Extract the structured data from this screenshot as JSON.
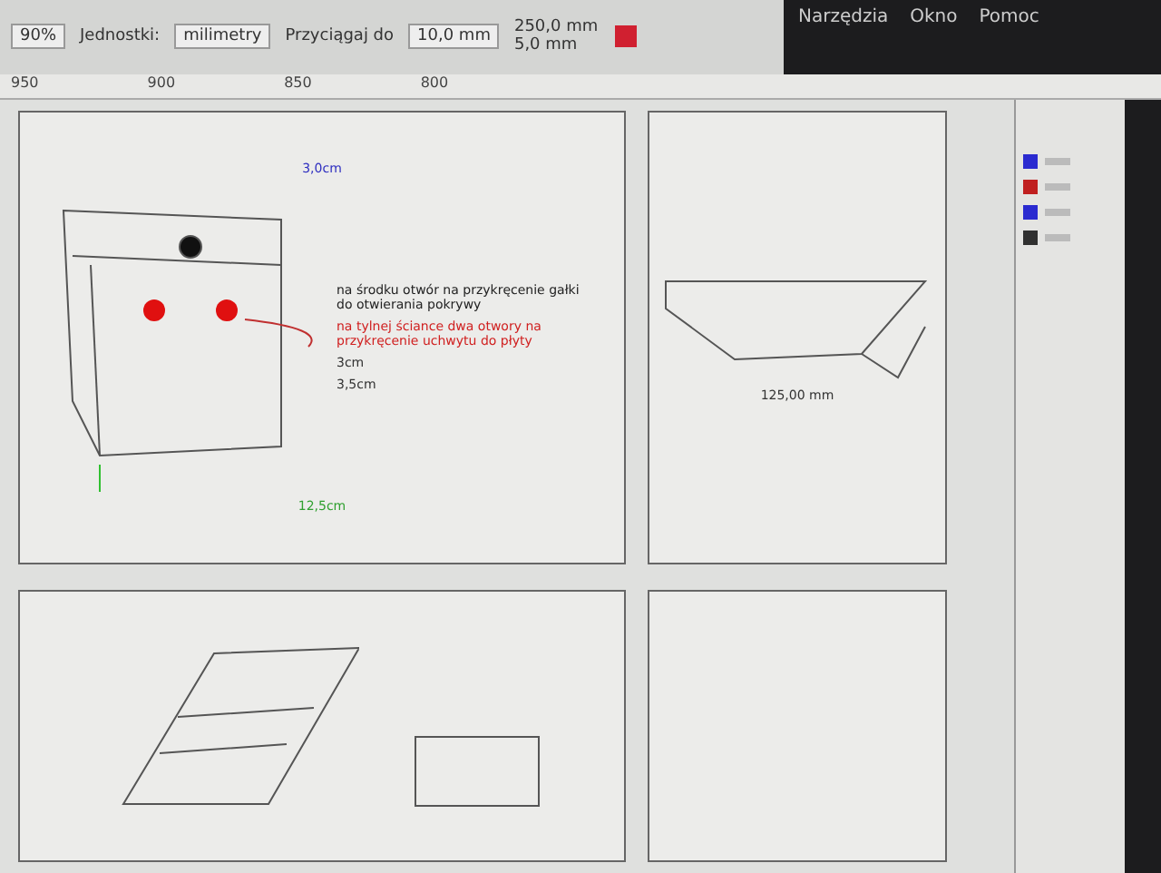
{
  "menu": [
    {
      "label": "Narzędzia"
    },
    {
      "label": "Okno"
    },
    {
      "label": "Pomoc"
    }
  ],
  "toolbar": {
    "zoom": "90%",
    "units_label": "Jednostki:",
    "units": "milimetry",
    "snap": "Przyciągaj do",
    "nudge": "10,0 mm",
    "dup_x": "250,0 mm",
    "dup_y": "5,0 mm"
  },
  "ruler": [
    "950",
    "900",
    "850",
    "800"
  ],
  "pages": [
    {
      "kind": "box",
      "top_dim": "3,0cm",
      "note": "na środku otwór na przykręcenie gałki do otwierania pokrywy",
      "red_note": "na tylnej ściance dwa otwory na przykręcenie uchwytu do płyty",
      "side_dim": "3cm",
      "corner_dim": "3,5cm",
      "width_dim": "12,5cm"
    },
    {
      "kind": "profile",
      "width_dim": "125,00 mm"
    },
    {
      "kind": "iso"
    },
    {
      "kind": "blank"
    }
  ],
  "layers": [
    {
      "color": "#2a2ad0"
    },
    {
      "color": "#c02020"
    },
    {
      "color": "#2a2ad0"
    },
    {
      "color": "#303030"
    }
  ]
}
